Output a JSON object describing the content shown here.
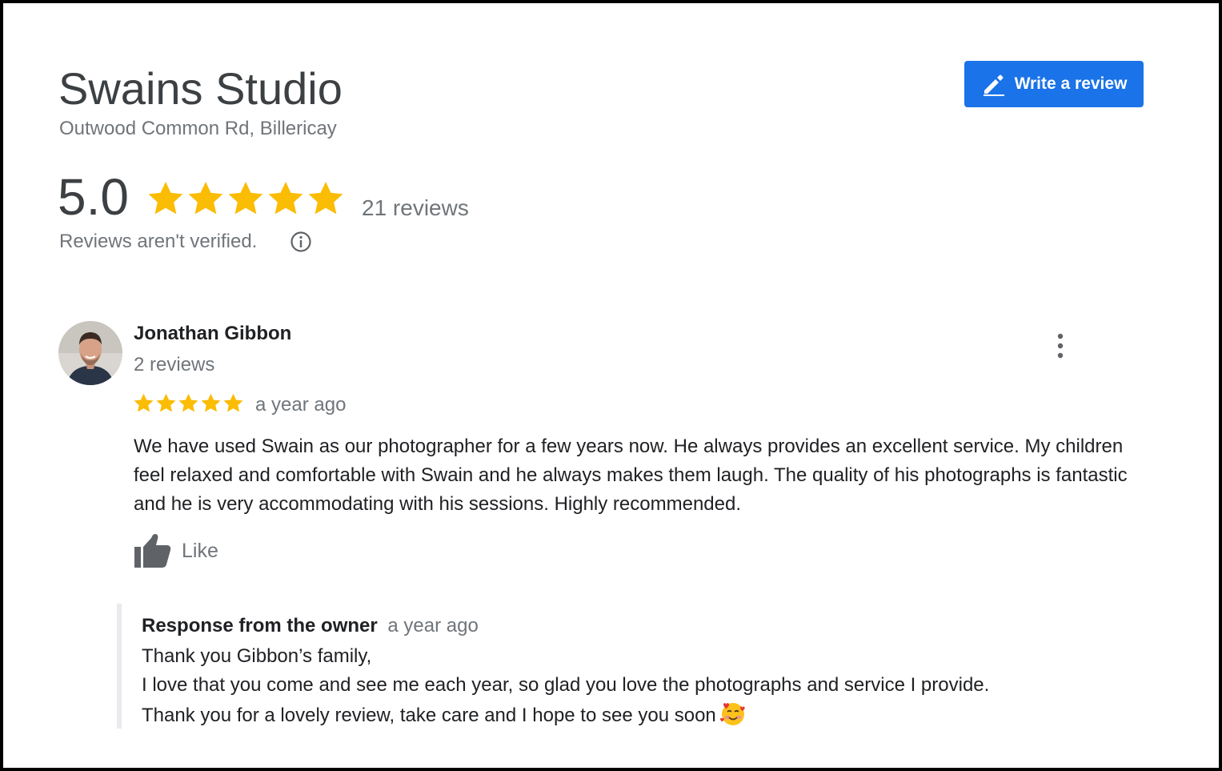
{
  "business": {
    "name": "Swains Studio",
    "address": "Outwood Common Rd, Billericay"
  },
  "actions": {
    "write_review_label": "Write a review"
  },
  "summary": {
    "rating": "5.0",
    "stars": 5,
    "review_count": "21 reviews",
    "verification_note": "Reviews aren't verified."
  },
  "colors": {
    "star": "#fbbc04",
    "primary_button": "#1a73e8"
  },
  "icons": {
    "write_review": "pencil-icon",
    "info": "info-icon",
    "more": "more-vert-icon",
    "like": "thumbs-up-icon",
    "emoji": "smiling-face-with-hearts-emoji"
  },
  "review": {
    "author": "Jonathan Gibbon",
    "author_reviews": "2 reviews",
    "stars": 5,
    "time": "a year ago",
    "text": "We have used Swain as our photographer for a few years now. He always provides an excellent service. My children feel relaxed and comfortable with Swain and he always makes them laugh. The quality of his photographs is fantastic and he is very accommodating with his sessions. Highly recommended.",
    "like_label": "Like"
  },
  "response": {
    "title": "Response from the owner",
    "time": "a year ago",
    "lines": [
      "Thank you Gibbon’s family,",
      "I love that you come and see me each year, so glad you love the photographs and service I provide.",
      "Thank you for a lovely review, take care and I hope to see you soon"
    ]
  }
}
